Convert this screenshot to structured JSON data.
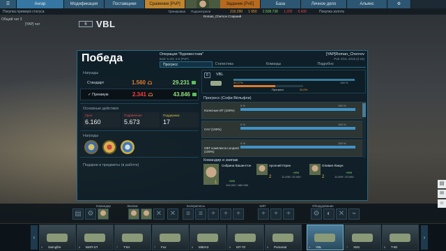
{
  "topnav": {
    "tabs": [
      "Ангар",
      "Модификация",
      "Поставщики",
      "Сражение [PvP]",
      "Задание [PvE]",
      "База",
      "Личное дело",
      "Альянс"
    ],
    "profile_caption_left": "Тренировка",
    "profile_caption_right": "Подсмотрели",
    "profile_name": "Roman_Chernov Старший"
  },
  "substrip": {
    "left": "Покупка премиум статуса",
    "res": [
      "210.290",
      "1 650",
      "2.508.738",
      "1.200",
      "6.430"
    ],
    "right": "Покупка золота"
  },
  "left_tools": {
    "group": "Общий чат 3",
    "channel": "[YAP] чат"
  },
  "vehicle_header": {
    "tier": "6",
    "name": "VBL"
  },
  "panel": {
    "title": "Победа",
    "operation": "Операция \"Буревестник\"",
    "operation_sub": "Бой: 6.3/3, 6.9 (PvP)",
    "player": "[YAP]Roman_Chernov",
    "player_sub": "PvE 4/10, 2015 (2:16)",
    "tabs": [
      "Прогресс",
      "Статистика",
      "Команды",
      "Подробно"
    ],
    "rewards_label": "Награды",
    "rewards": [
      {
        "label": "Стандарт",
        "v1": "1.560",
        "v2": "29.231"
      },
      {
        "label": "✓ Премиум",
        "v1": "2.341",
        "v2": "43.846"
      }
    ],
    "actions_label": "Основные действия",
    "actions": [
      {
        "name": "Урон",
        "value": "6.160"
      },
      {
        "name": "Подавление",
        "value": "5.673"
      },
      {
        "name": "Поддержка",
        "value": "17"
      }
    ],
    "medals_label": "Награды",
    "gifts": "Подарки и предметы (в работе)"
  },
  "right": {
    "veh_tier": "6",
    "veh_name": "VBL",
    "bar_a_pct": "30,27%",
    "bar_b_pct": "100 %",
    "prog_label": "Прогресс",
    "bar_c_pct": "30,0%",
    "progress_title": "Прогресс (Софи Вёльфли)",
    "progress": [
      {
        "label": "Колесные ИТ (100%)",
        "left": "0 %",
        "right": "100 %",
        "fill": 1.0
      },
      {
        "label": "САУ (100%)",
        "left": "0 %",
        "right": "100 %",
        "fill": 1.0
      },
      {
        "label": "ОБТ комплекта Leopard (100%)",
        "left": "0 %",
        "right": "100 %",
        "fill": 1.0
      }
    ],
    "crew_title": "Командир и экипаж",
    "crew": [
      {
        "name": "Сибрина Вашингтон",
        "xp": "+699",
        "level": "1",
        "total": "100.000 / 580.000"
      },
      {
        "name": "Арсений Герин",
        "xp": "+699",
        "level": "2",
        "total": "11.498 / 20.000"
      },
      {
        "name": "Оливия Ламун",
        "xp": "+699",
        "level": "2",
        "total": "11.699 / 20.000"
      }
    ]
  },
  "loadout": {
    "labels": [
      "Командир",
      "Экипаж",
      "Боеприпасы",
      "ЗИП",
      "Оборудование"
    ]
  },
  "carousel": {
    "tanks": [
      {
        "tier": "9",
        "name": "Swingfire"
      },
      {
        "tier": "8",
        "name": "БМП-1П"
      },
      {
        "tier": "7",
        "name": "T-84"
      },
      {
        "tier": "7",
        "name": "Fox"
      },
      {
        "tier": "8",
        "name": "M60A3"
      },
      {
        "tier": "6",
        "name": "МТ-70"
      },
      {
        "tier": "5",
        "name": "Pumarad"
      },
      {
        "tier": "6",
        "name": "VBL"
      },
      {
        "tier": "7",
        "name": "XM1"
      },
      {
        "tier": "8",
        "name": "T-80"
      }
    ]
  }
}
